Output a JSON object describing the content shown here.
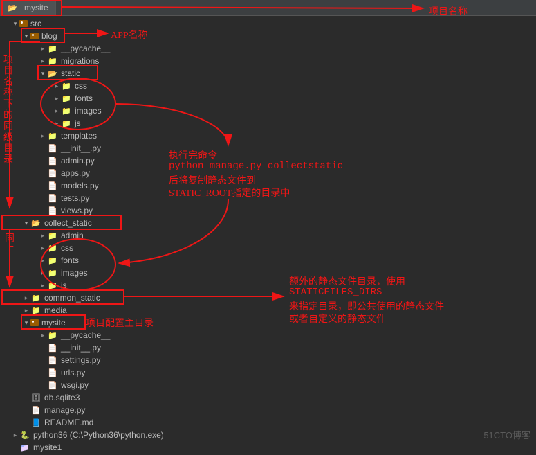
{
  "tab": {
    "title": "mysite"
  },
  "tree": [
    {
      "indent": 16,
      "arrow": "down",
      "icon": "pkg-icon",
      "label": "src"
    },
    {
      "indent": 32,
      "arrow": "down",
      "icon": "pkg-icon",
      "label": "blog"
    },
    {
      "indent": 56,
      "arrow": "right",
      "icon": "folder-icon",
      "label": "__pycache__"
    },
    {
      "indent": 56,
      "arrow": "right",
      "icon": "folder-icon",
      "label": "migrations"
    },
    {
      "indent": 56,
      "arrow": "down",
      "icon": "folder-open",
      "label": "static"
    },
    {
      "indent": 76,
      "arrow": "right",
      "icon": "folder-icon",
      "label": "css"
    },
    {
      "indent": 76,
      "arrow": "right",
      "icon": "folder-icon",
      "label": "fonts"
    },
    {
      "indent": 76,
      "arrow": "right",
      "icon": "folder-icon",
      "label": "images"
    },
    {
      "indent": 76,
      "arrow": "right",
      "icon": "folder-icon",
      "label": "js"
    },
    {
      "indent": 56,
      "arrow": "right",
      "icon": "folder-icon",
      "label": "templates"
    },
    {
      "indent": 56,
      "arrow": "none",
      "icon": "py-icon",
      "label": "__init__.py"
    },
    {
      "indent": 56,
      "arrow": "none",
      "icon": "py-icon",
      "label": "admin.py"
    },
    {
      "indent": 56,
      "arrow": "none",
      "icon": "py-icon",
      "label": "apps.py"
    },
    {
      "indent": 56,
      "arrow": "none",
      "icon": "py-icon",
      "label": "models.py"
    },
    {
      "indent": 56,
      "arrow": "none",
      "icon": "py-icon",
      "label": "tests.py"
    },
    {
      "indent": 56,
      "arrow": "none",
      "icon": "py-icon",
      "label": "views.py"
    },
    {
      "indent": 32,
      "arrow": "down",
      "icon": "folder-open",
      "label": "collect_static"
    },
    {
      "indent": 56,
      "arrow": "right",
      "icon": "folder-icon",
      "label": "admin"
    },
    {
      "indent": 56,
      "arrow": "right",
      "icon": "folder-icon",
      "label": "css"
    },
    {
      "indent": 56,
      "arrow": "right",
      "icon": "folder-icon",
      "label": "fonts"
    },
    {
      "indent": 56,
      "arrow": "right",
      "icon": "folder-icon",
      "label": "images"
    },
    {
      "indent": 56,
      "arrow": "right",
      "icon": "folder-icon",
      "label": "js"
    },
    {
      "indent": 32,
      "arrow": "right",
      "icon": "folder-icon",
      "label": "common_static"
    },
    {
      "indent": 32,
      "arrow": "right",
      "icon": "folder-icon",
      "label": "media"
    },
    {
      "indent": 32,
      "arrow": "down",
      "icon": "pkg-icon",
      "label": "mysite"
    },
    {
      "indent": 56,
      "arrow": "right",
      "icon": "folder-icon",
      "label": "__pycache__"
    },
    {
      "indent": 56,
      "arrow": "none",
      "icon": "py-icon",
      "label": "__init__.py"
    },
    {
      "indent": 56,
      "arrow": "none",
      "icon": "py-icon",
      "label": "settings.py"
    },
    {
      "indent": 56,
      "arrow": "none",
      "icon": "py-icon",
      "label": "urls.py"
    },
    {
      "indent": 56,
      "arrow": "none",
      "icon": "py-icon",
      "label": "wsgi.py"
    },
    {
      "indent": 32,
      "arrow": "none",
      "icon": "db-icon",
      "label": "db.sqlite3"
    },
    {
      "indent": 32,
      "arrow": "none",
      "icon": "py-icon",
      "label": "manage.py"
    },
    {
      "indent": 32,
      "arrow": "none",
      "icon": "md-icon",
      "label": "README.md"
    },
    {
      "indent": 16,
      "arrow": "right",
      "icon": "python-env",
      "label": "python36  (C:\\Python36\\python.exe)"
    },
    {
      "indent": 16,
      "arrow": "none",
      "icon": "proj-icon",
      "label": "mysite1"
    }
  ],
  "annotations": {
    "app_name": "APP名称",
    "project_name": "项目名称",
    "side_text": "项目名称下的同级目录",
    "side_text2": "同上",
    "static_cmd_1": "执行完命令",
    "static_cmd_2": "python manage.py collectstatic",
    "static_cmd_3": "后将复制静态文件到",
    "static_cmd_4": "STATIC_ROOT指定的目录中",
    "extra_1": "额外的静态文件目录，使用",
    "extra_2": "STATICFILES_DIRS",
    "extra_3": "来指定目录，即公共使用的静态文件",
    "extra_4": "或者自定义的静态文件",
    "config_dir": "项目配置主目录"
  },
  "watermark": "51CTO博客"
}
